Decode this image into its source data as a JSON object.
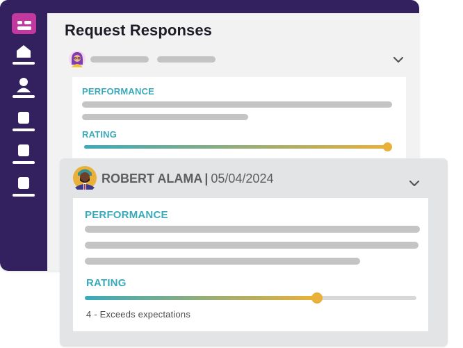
{
  "page": {
    "title": "Request Responses"
  },
  "back_response": {
    "performance_label": "PERFORMANCE",
    "rating_label": "RATING",
    "rating_fraction": 1.0
  },
  "front_response": {
    "person_name": "ROBERT ALAMA",
    "separator": "|",
    "date": "05/04/2024",
    "performance_label": "PERFORMANCE",
    "rating_label": "RATING",
    "rating_fraction": 0.7,
    "rating_result": "4 - Exceeds expectations"
  },
  "sidebar": {
    "items": [
      {
        "icon": "home-icon"
      },
      {
        "icon": "user-icon"
      },
      {
        "icon": "document-icon"
      },
      {
        "icon": "document-icon"
      },
      {
        "icon": "document-icon"
      }
    ]
  },
  "colors": {
    "sidebar_bg": "#33205f",
    "logo_bg": "#c2389e",
    "accent_teal": "#3aaabb",
    "accent_gold": "#e9b03a"
  }
}
